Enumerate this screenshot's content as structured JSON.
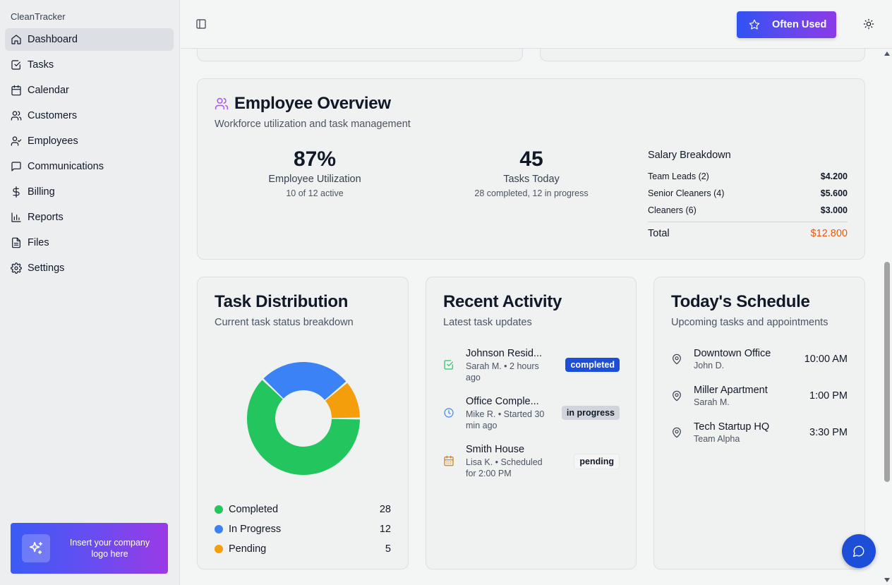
{
  "app": {
    "name": "CleanTracker"
  },
  "sidebar": {
    "items": [
      {
        "label": "Dashboard",
        "icon": "home-icon"
      },
      {
        "label": "Tasks",
        "icon": "check-square-icon"
      },
      {
        "label": "Calendar",
        "icon": "calendar-icon"
      },
      {
        "label": "Customers",
        "icon": "users-icon"
      },
      {
        "label": "Employees",
        "icon": "user-check-icon"
      },
      {
        "label": "Communications",
        "icon": "message-icon"
      },
      {
        "label": "Billing",
        "icon": "dollar-icon"
      },
      {
        "label": "Reports",
        "icon": "bar-chart-icon"
      },
      {
        "label": "Files",
        "icon": "file-icon"
      },
      {
        "label": "Settings",
        "icon": "gear-icon"
      }
    ],
    "logo_placeholder": "Insert your company logo here"
  },
  "header": {
    "often_used_label": "Often Used"
  },
  "employee_overview": {
    "title": "Employee Overview",
    "subtitle": "Workforce utilization and task management",
    "utilization": {
      "value": "87%",
      "label": "Employee Utilization",
      "note": "10 of 12 active"
    },
    "tasks_today": {
      "value": "45",
      "label": "Tasks Today",
      "note": "28 completed, 12 in progress"
    },
    "salary": {
      "title": "Salary Breakdown",
      "rows": [
        {
          "label": "Team Leads (2)",
          "amount": "$4.200"
        },
        {
          "label": "Senior Cleaners (4)",
          "amount": "$5.600"
        },
        {
          "label": "Cleaners (6)",
          "amount": "$3.000"
        }
      ],
      "total_label": "Total",
      "total_amount": "$12.800"
    }
  },
  "task_distribution": {
    "title": "Task Distribution",
    "subtitle": "Current task status breakdown",
    "legend": [
      {
        "label": "Completed",
        "count": "28",
        "color": "#22c55e"
      },
      {
        "label": "In Progress",
        "count": "12",
        "color": "#3b82f6"
      },
      {
        "label": "Pending",
        "count": "5",
        "color": "#f59e0b"
      }
    ]
  },
  "chart_data": {
    "type": "pie",
    "categories": [
      "Completed",
      "In Progress",
      "Pending"
    ],
    "values": [
      28,
      12,
      5
    ],
    "colors": [
      "#22c55e",
      "#3b82f6",
      "#f59e0b"
    ],
    "title": "Task Distribution"
  },
  "recent_activity": {
    "title": "Recent Activity",
    "subtitle": "Latest task updates",
    "items": [
      {
        "name": "Johnson Resid...",
        "meta": "Sarah M. • 2 hours ago",
        "status": "completed",
        "icon": "check-square-icon"
      },
      {
        "name": "Office Comple...",
        "meta": "Mike R. • Started 30 min ago",
        "status": "in progress",
        "icon": "clock-icon"
      },
      {
        "name": "Smith House",
        "meta": "Lisa K. • Scheduled for 2:00 PM",
        "status": "pending",
        "icon": "calendar-icon"
      }
    ]
  },
  "schedule": {
    "title": "Today's Schedule",
    "subtitle": "Upcoming tasks and appointments",
    "items": [
      {
        "name": "Downtown Office",
        "who": "John D.",
        "time": "10:00 AM"
      },
      {
        "name": "Miller Apartment",
        "who": "Sarah M.",
        "time": "1:00 PM"
      },
      {
        "name": "Tech Startup HQ",
        "who": "Team Alpha",
        "time": "3:30 PM"
      }
    ]
  }
}
